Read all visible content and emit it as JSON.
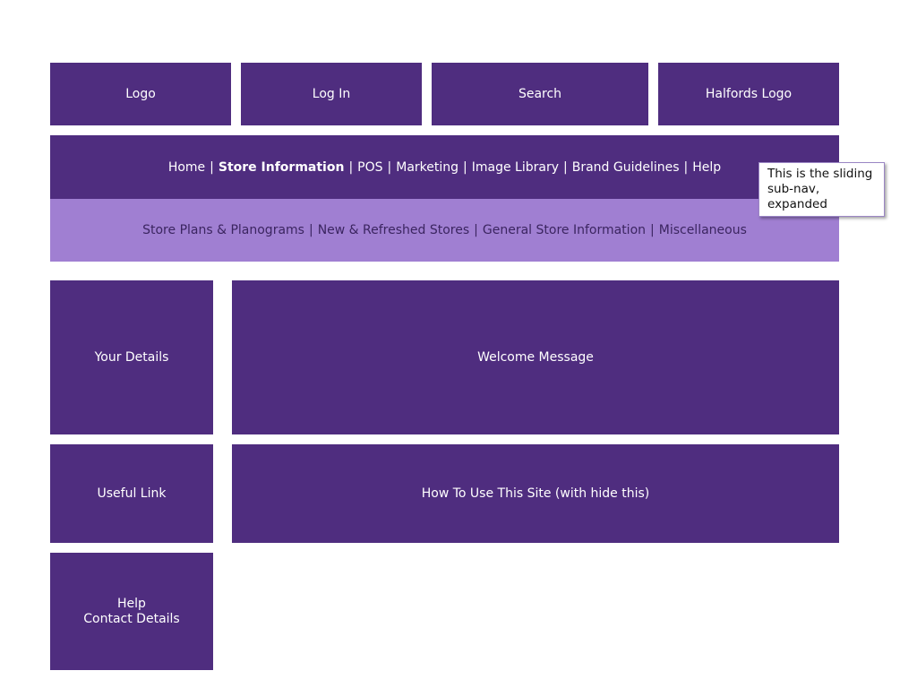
{
  "header": {
    "logo": "Logo",
    "login": "Log In",
    "search": "Search",
    "halfords_logo": "Halfords Logo"
  },
  "main_nav": {
    "items": [
      {
        "label": "Home",
        "active": false
      },
      {
        "label": "Store Information",
        "active": true
      },
      {
        "label": "POS",
        "active": false
      },
      {
        "label": "Marketing",
        "active": false
      },
      {
        "label": "Image Library",
        "active": false
      },
      {
        "label": "Brand Guidelines",
        "active": false
      },
      {
        "label": "Help",
        "active": false
      }
    ],
    "separator": "|"
  },
  "sub_nav": {
    "items": [
      {
        "label": "Store Plans & Planograms"
      },
      {
        "label": "New & Refreshed Stores"
      },
      {
        "label": "General Store Information"
      },
      {
        "label": "Miscellaneous"
      }
    ],
    "separator": "|"
  },
  "callout": {
    "text": "This is the sliding sub-nav, expanded"
  },
  "sidebar": {
    "your_details": "Your Details",
    "useful_link": "Useful Link",
    "help_line1": "Help",
    "help_line2": "Contact Details"
  },
  "main": {
    "welcome": "Welcome Message",
    "how_to": "How To Use This Site (with hide this)"
  },
  "colors": {
    "primary_purple": "#4f2d7f",
    "subnav_lilac": "#a07fd2",
    "subnav_text": "#3b2560",
    "background": "#ffffff"
  }
}
